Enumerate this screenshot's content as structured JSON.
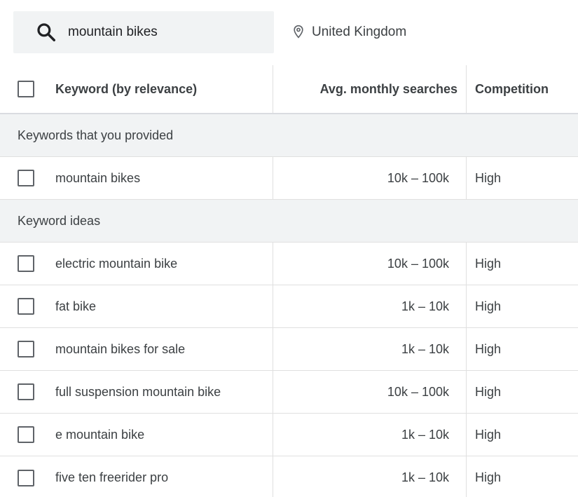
{
  "search": {
    "query": "mountain bikes",
    "location": "United Kingdom"
  },
  "columns": {
    "keyword": "Keyword (by relevance)",
    "searches": "Avg. monthly searches",
    "competition": "Competition"
  },
  "groups": [
    {
      "label": "Keywords that you provided",
      "rows": [
        {
          "keyword": "mountain bikes",
          "searches": "10k – 100k",
          "competition": "High"
        }
      ]
    },
    {
      "label": "Keyword ideas",
      "rows": [
        {
          "keyword": "electric mountain bike",
          "searches": "10k – 100k",
          "competition": "High"
        },
        {
          "keyword": "fat bike",
          "searches": "1k – 10k",
          "competition": "High"
        },
        {
          "keyword": "mountain bikes for sale",
          "searches": "1k – 10k",
          "competition": "High"
        },
        {
          "keyword": "full suspension mountain bike",
          "searches": "10k – 100k",
          "competition": "High"
        },
        {
          "keyword": "e mountain bike",
          "searches": "1k – 10k",
          "competition": "High"
        },
        {
          "keyword": "five ten freerider pro",
          "searches": "1k – 10k",
          "competition": "High"
        }
      ]
    }
  ],
  "icons": {
    "search": "search-icon",
    "location": "location-pin-icon"
  },
  "colors": {
    "group_bg": "#f1f3f4",
    "search_bg": "#f1f3f4",
    "text": "#3c4043"
  }
}
